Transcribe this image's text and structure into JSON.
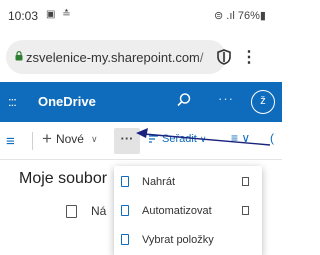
{
  "status_bar": {
    "time": "10:03",
    "left_icons": "▣ ≛",
    "signal_battery": "⊜ .ıl 76%▮"
  },
  "browser": {
    "url": "zsvelenice-my.sharepoint.com/",
    "shield_icon": "shield-icon",
    "menu_icon": "vertical-dots-icon",
    "menu_glyph": "⋮"
  },
  "app_header": {
    "waffle_glyph": ":::",
    "title": "OneDrive",
    "search_glyph": "⌕",
    "more_glyph": "···",
    "avatar_initial": "ž",
    "brand_color": "#0f6cbd"
  },
  "command_bar": {
    "hamburger_glyph": "≡",
    "new_plus": "+",
    "new_label": "Nové",
    "chevron": "∨",
    "more_glyph": "···",
    "sort_label": "Seřadit",
    "view_glyph": "≡ ∨",
    "info_glyph": "("
  },
  "page": {
    "title": "Moje soubor",
    "column_name": "Ná"
  },
  "dropdown_menu": {
    "items": [
      {
        "label": "Nahrát",
        "has_submenu": true
      },
      {
        "label": "Automatizovat",
        "has_submenu": true
      },
      {
        "label": "Vybrat položky",
        "has_submenu": false
      }
    ]
  },
  "annotation": {
    "arrow_color": "#1a237e"
  }
}
